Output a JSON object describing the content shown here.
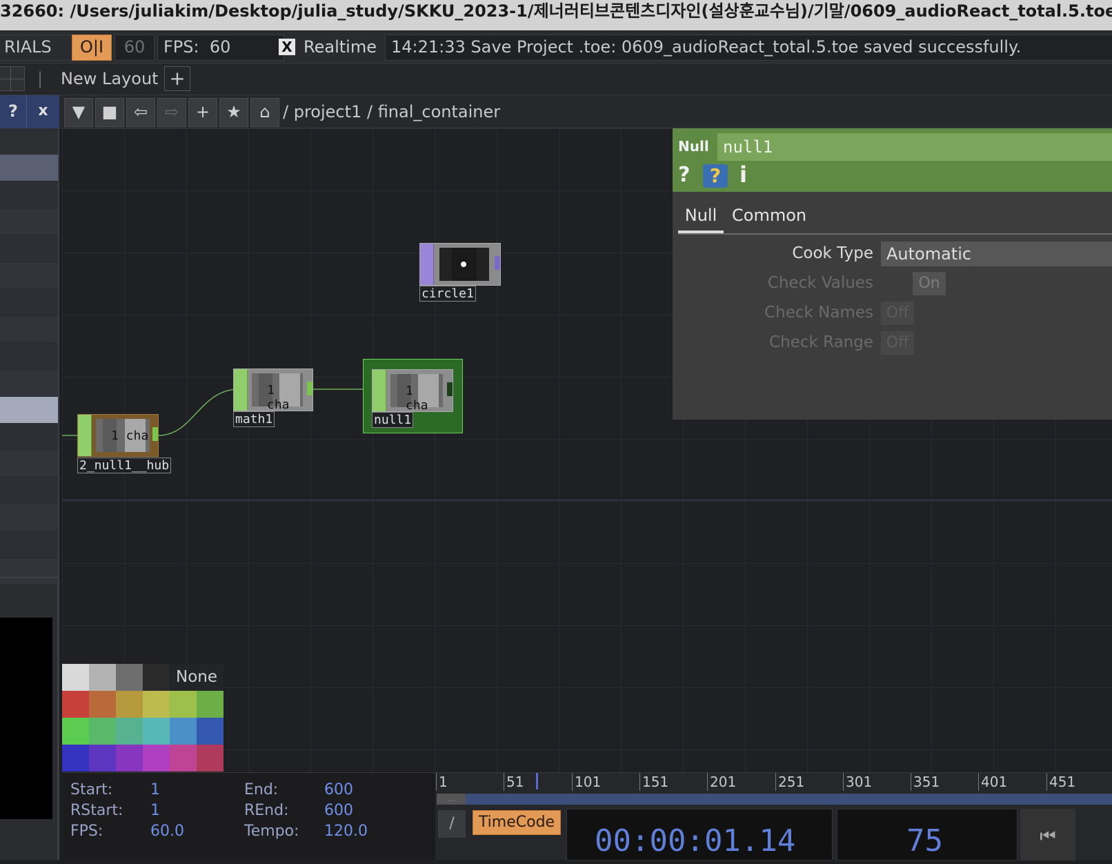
{
  "title_bar": {
    "text": "32660: /Users/juliakim/Desktop/julia_study/SKKU_2023-1/제너러티브콘텐츠디자인(설상훈교수님)/기말/0609_audioReact_total.5.toe"
  },
  "status_bar": {
    "materials": "RIALS",
    "oi_toggle": "O|I",
    "fps_target": "60",
    "fps_label": "FPS:",
    "fps_value": "60",
    "realtime_check": "X",
    "realtime_label": "Realtime",
    "message": "14:21:33 Save Project .toe: 0609_audioReact_total.5.toe saved successfully."
  },
  "layout_bar": {
    "separator": "|",
    "label": "New Layout",
    "add": "+"
  },
  "path_bar": {
    "help": "?",
    "close": "x",
    "buttons": {
      "dropdown": "▼",
      "stop": "■",
      "back": "⇦",
      "forward": "⇨",
      "add": "+",
      "star": "★",
      "home": "⌂"
    },
    "path_sep1": "/",
    "path_root": "project1",
    "path_sep2": "/",
    "path_current": "final_container"
  },
  "nodes": {
    "circle1": {
      "label": "circle1"
    },
    "math1": {
      "label": "math1",
      "preview": "1 cha"
    },
    "null1": {
      "label": "null1",
      "preview": "1 cha"
    },
    "null_hub": {
      "label": "2_null1__hub",
      "preview": "1 cha"
    }
  },
  "params": {
    "op_type": "Null",
    "op_name": "null1",
    "icons": {
      "help": "?",
      "python_help": "?",
      "info": "i"
    },
    "tabs": [
      "Null",
      "Common"
    ],
    "rows": [
      {
        "label": "Cook Type",
        "value": "Automatic"
      },
      {
        "label": "Check Values",
        "value": "On"
      },
      {
        "label": "Check Names",
        "value": "Off"
      },
      {
        "label": "Check Range",
        "value": "Off"
      }
    ]
  },
  "palette": {
    "none_label": "None",
    "gray_colors": [
      "#d9d9d9",
      "#b3b3b3",
      "#6e6e6e",
      "#2a2a2a"
    ],
    "colors": [
      "#c8403a",
      "#b86a3a",
      "#b89a3e",
      "#bcbc4e",
      "#9cc04a",
      "#6cae48",
      "#5ccc50",
      "#5ab86a",
      "#56b290",
      "#58b8b8",
      "#4c90c8",
      "#3458b0",
      "#3434c0",
      "#5c36c0",
      "#8836c0",
      "#b040c0",
      "#c04494",
      "#b03a5c"
    ]
  },
  "time_panel": {
    "start_label": "Start:",
    "start_value": "1",
    "end_label": "End:",
    "end_value": "600",
    "rstart_label": "RStart:",
    "rstart_value": "1",
    "rend_label": "REnd:",
    "rend_value": "600",
    "fps_label": "FPS:",
    "fps_value": "60.0",
    "tempo_label": "Tempo:",
    "tempo_value": "120.0"
  },
  "timeline": {
    "ticks": [
      "1",
      "51",
      "101",
      "151",
      "201",
      "251",
      "301",
      "351",
      "401",
      "451"
    ],
    "range_handle": "...",
    "slash": "/",
    "timecode_label": "TimeCode",
    "timecode_value": "00:00:01.14",
    "frame_value": "75",
    "rewind": "⏮"
  }
}
